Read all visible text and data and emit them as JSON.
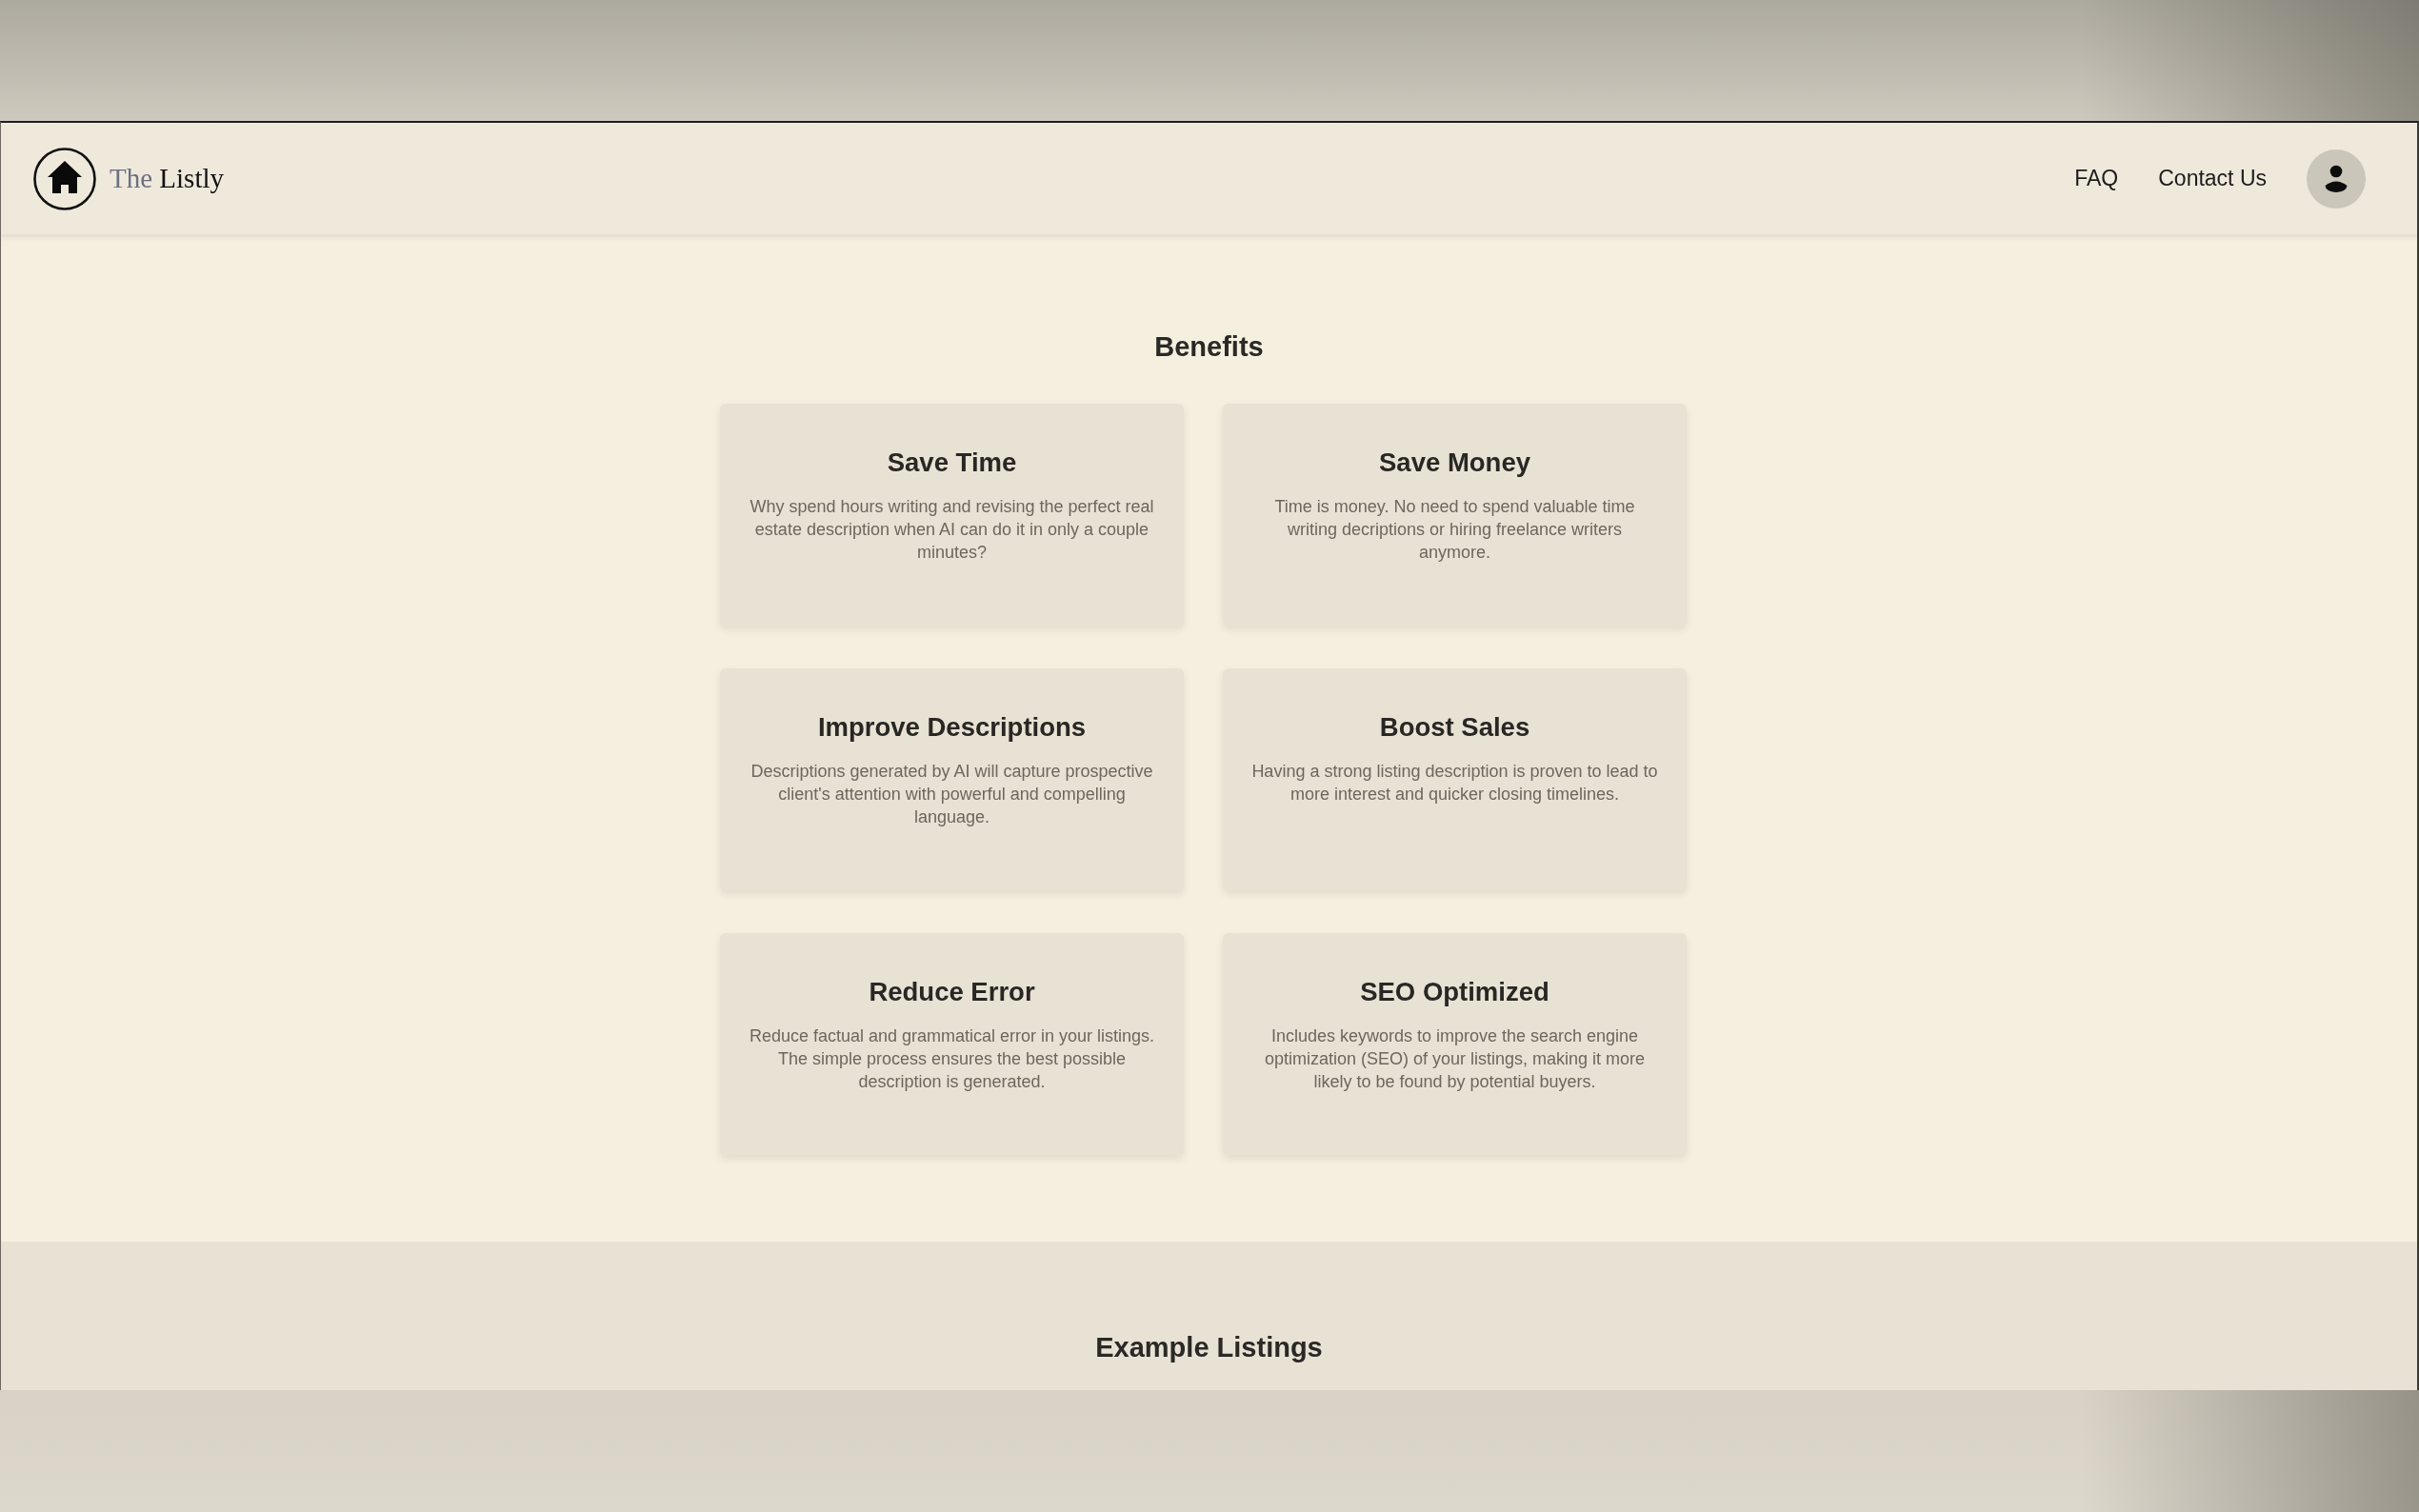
{
  "navbar": {
    "brand": {
      "prefix": "The",
      "name": "Listly"
    },
    "links": [
      "FAQ",
      "Contact Us"
    ]
  },
  "benefits": {
    "title": "Benefits",
    "cards": [
      {
        "title": "Save Time",
        "text": "Why spend hours writing and revising the perfect real estate description when AI can do it in only a couple minutes?"
      },
      {
        "title": "Save Money",
        "text": "Time is money. No need to spend valuable time writing decriptions or hiring freelance writers anymore."
      },
      {
        "title": "Improve Descriptions",
        "text": "Descriptions generated by AI will capture prospective client's attention with powerful and compelling language."
      },
      {
        "title": "Boost Sales",
        "text": "Having a strong listing description is proven to lead to more interest and quicker closing timelines."
      },
      {
        "title": "Reduce Error",
        "text": "Reduce factual and grammatical error in your listings. The simple process ensures the best possible description is generated."
      },
      {
        "title": "SEO Optimized",
        "text": "Includes keywords to improve the search engine optimization (SEO) of your listings, making it more likely to be found by potential buyers."
      }
    ]
  },
  "example_listings": {
    "title": "Example Listings"
  }
}
